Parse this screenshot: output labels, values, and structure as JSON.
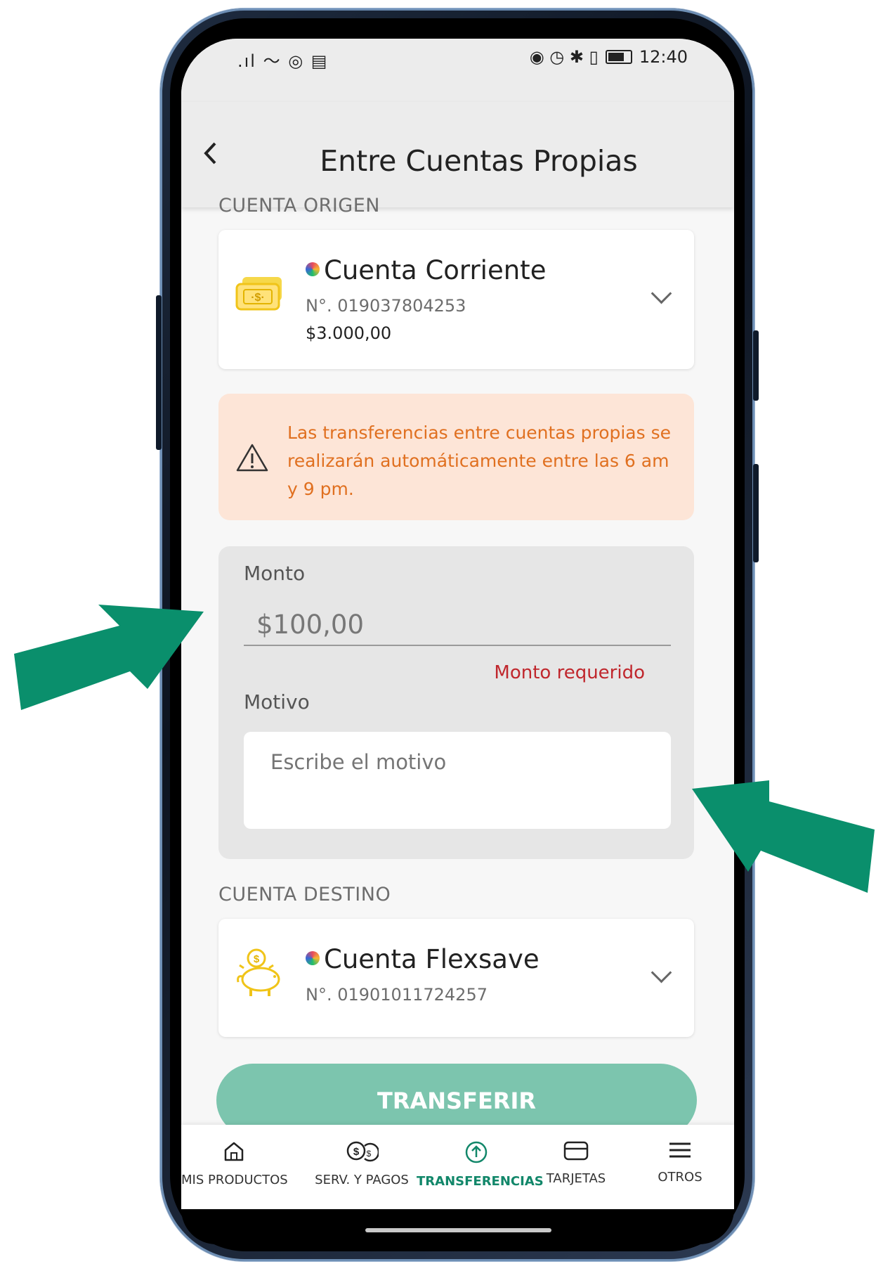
{
  "status_bar": {
    "left_icons": ".ıl 〜 ◎ ▤",
    "right_icons": "◉ ◷ ✱ ▯ ",
    "time": "12:40"
  },
  "header": {
    "title": "Entre Cuentas Propias"
  },
  "origin": {
    "section_label": "CUENTA ORIGEN",
    "account_name": "Cuenta Corriente",
    "account_number": "N°. 019037804253",
    "balance": "$3.000,00"
  },
  "warning": {
    "text": "Las transferencias entre cuentas propias se realizarán automáticamente entre las 6 am y 9 pm."
  },
  "form": {
    "amount_label": "Monto",
    "amount_value": "$100,00",
    "amount_error": "Monto requerido",
    "reason_label": "Motivo",
    "reason_placeholder": "Escribe el motivo"
  },
  "destination": {
    "section_label": "CUENTA DESTINO",
    "account_name": "Cuenta Flexsave",
    "account_number": "N°. 01901011724257"
  },
  "transfer_button": "TRANSFERIR",
  "bottom_nav": [
    {
      "label": "MIS PRODUCTOS",
      "icon": "home-icon"
    },
    {
      "label": "SERV. Y PAGOS",
      "icon": "coins-icon"
    },
    {
      "label": "TRANSFERENCIAS",
      "icon": "transfer-up-icon",
      "active": true
    },
    {
      "label": "TARJETAS",
      "icon": "card-icon"
    },
    {
      "label": "OTROS",
      "icon": "menu-icon"
    }
  ],
  "colors": {
    "accent": "#12876a",
    "button": "#7cc5ae",
    "warning_bg": "#fde5d7",
    "warning_text": "#e07020",
    "error": "#c0272d",
    "arrow": "#0a8f6c"
  }
}
